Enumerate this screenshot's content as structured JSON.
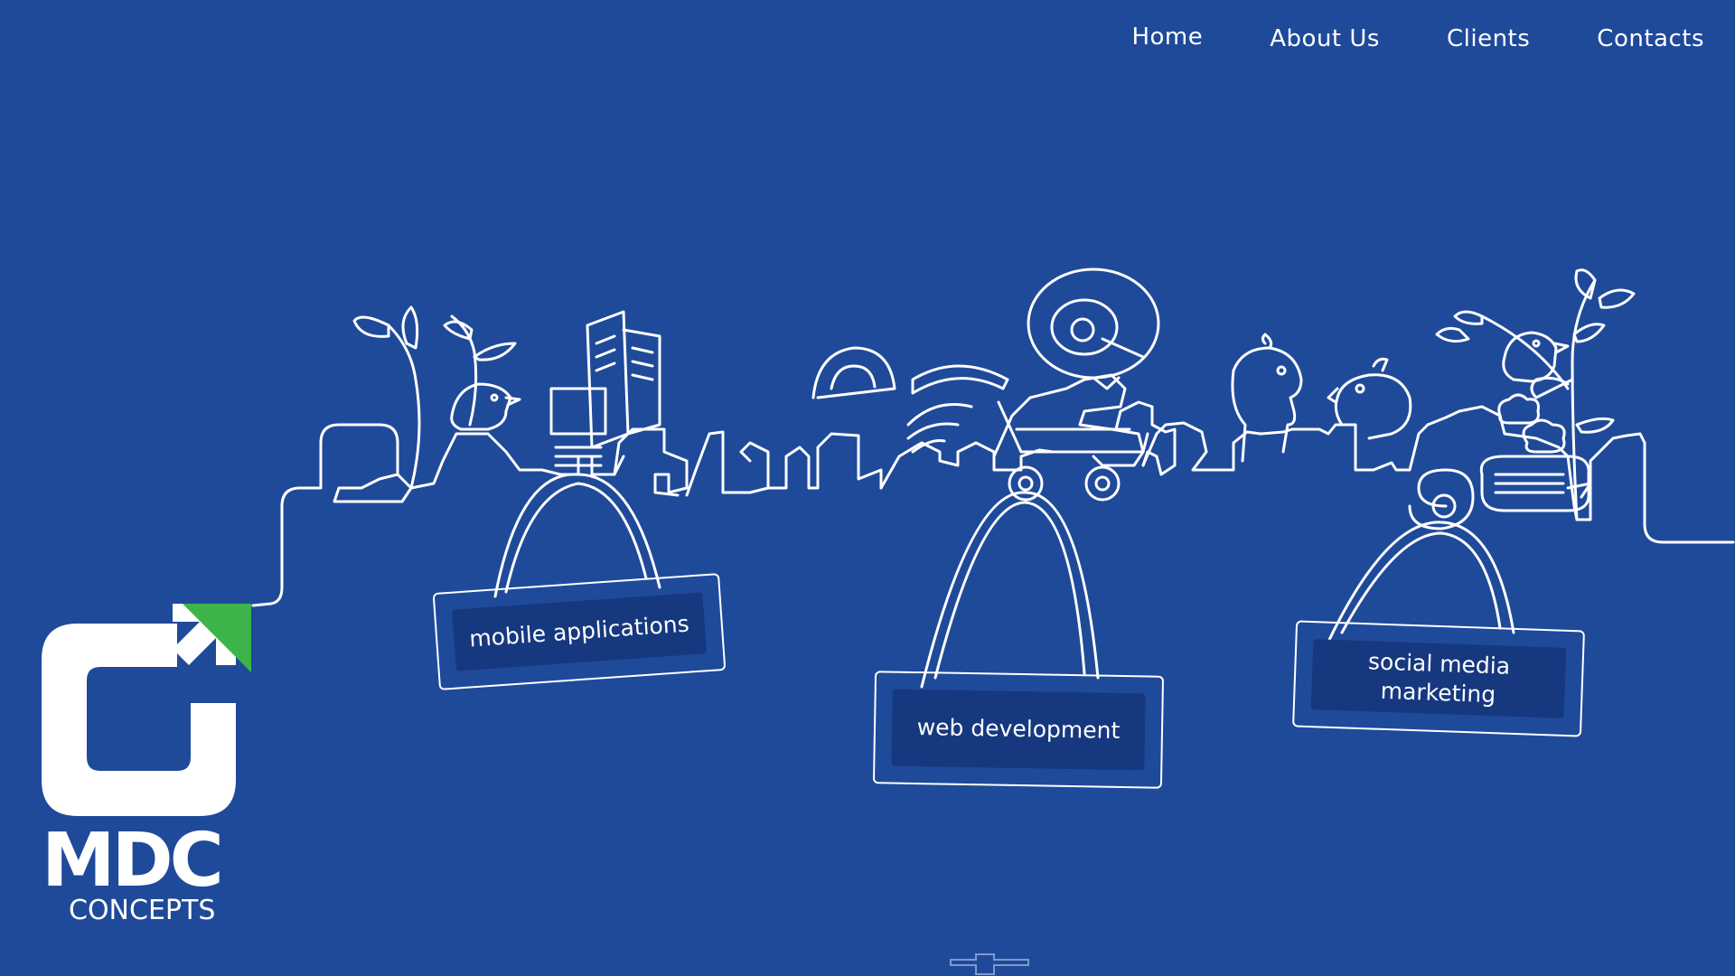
{
  "nav": {
    "items": [
      {
        "label": "Home"
      },
      {
        "label": "About Us"
      },
      {
        "label": "Clients"
      },
      {
        "label": "Contacts"
      }
    ]
  },
  "signs": {
    "mobile": "mobile applications",
    "web": "web development",
    "social": "social media\nmarketing"
  },
  "logo": {
    "line1": "MDC",
    "line2": "CONCEPTS",
    "accent_color": "#3cb44a"
  },
  "colors": {
    "background": "#1f4a9a",
    "sign_fill": "#16387f",
    "line": "#ffffff"
  },
  "icons": {
    "scroll": "scroll-down-icon"
  }
}
